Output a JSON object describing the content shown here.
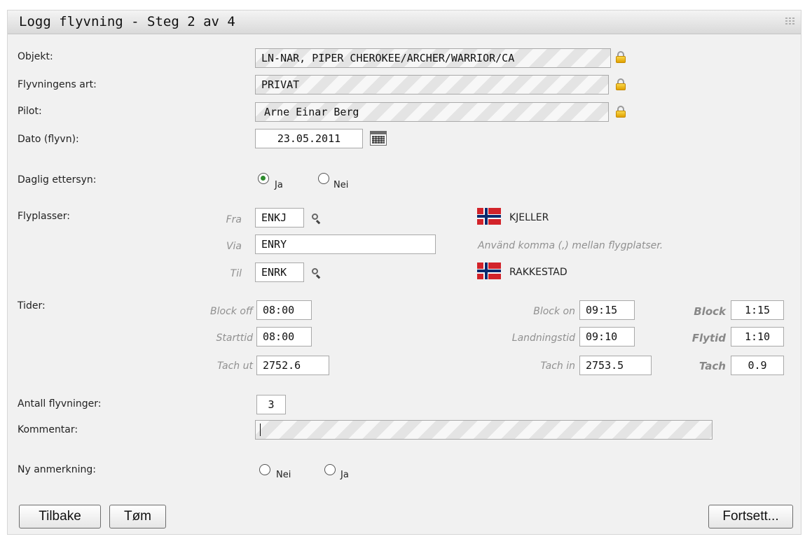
{
  "window": {
    "title": "Logg flyvning - Steg 2 av 4"
  },
  "labels": {
    "objekt": "Objekt:",
    "art": "Flyvningens art:",
    "pilot": "Pilot:",
    "dato": "Dato (flyvn):",
    "ettersyn": "Daglig ettersyn:",
    "flyplasser": "Flyplasser:",
    "tider": "Tider:",
    "antall": "Antall flyvninger:",
    "kommentar": "Kommentar:",
    "anmerkning": "Ny anmerkning:"
  },
  "values": {
    "objekt": "LN-NAR, PIPER CHEROKEE/ARCHER/WARRIOR/CA",
    "art": "PRIVAT",
    "pilot": "Arne Einar Berg",
    "dato": "23.05.2011",
    "antall": "3",
    "kommentar": ""
  },
  "ettersyn": {
    "ja": "Ja",
    "nei": "Nei",
    "selected": "Ja"
  },
  "flyplasser": {
    "fra_label": "Fra",
    "fra_code": "ENKJ",
    "fra_name": "KJELLER",
    "via_label": "Via",
    "via_code": "ENRY",
    "via_hint": "Använd komma (,) mellan flygplatser.",
    "til_label": "Til",
    "til_code": "ENRK",
    "til_name": "RAKKESTAD"
  },
  "tider": {
    "block_off_label": "Block off",
    "block_off": "08:00",
    "start_label": "Starttid",
    "start": "08:00",
    "tach_ut_label": "Tach ut",
    "tach_ut": "2752.6",
    "block_on_label": "Block on",
    "block_on": "09:15",
    "landing_label": "Landningstid",
    "landing": "09:10",
    "tach_in_label": "Tach in",
    "tach_in": "2753.5",
    "block_total_label": "Block",
    "block_total": "1:15",
    "flytid_label": "Flytid",
    "flytid": "1:10",
    "tach_total_label": "Tach",
    "tach_total": "0.9"
  },
  "anmerkning": {
    "nei": "Nei",
    "ja": "Ja",
    "selected": ""
  },
  "buttons": {
    "tilbake": "Tilbake",
    "tom": "Tøm",
    "fortsett": "Fortsett..."
  },
  "icons": {
    "lock": "lock-icon",
    "calendar": "calendar-icon",
    "search": "search-icon",
    "flag": "norway-flag-icon"
  },
  "colors": {
    "radio_selected": "#2e8b2e",
    "flag_red": "#d2232a",
    "flag_blue": "#0b2a6e"
  }
}
